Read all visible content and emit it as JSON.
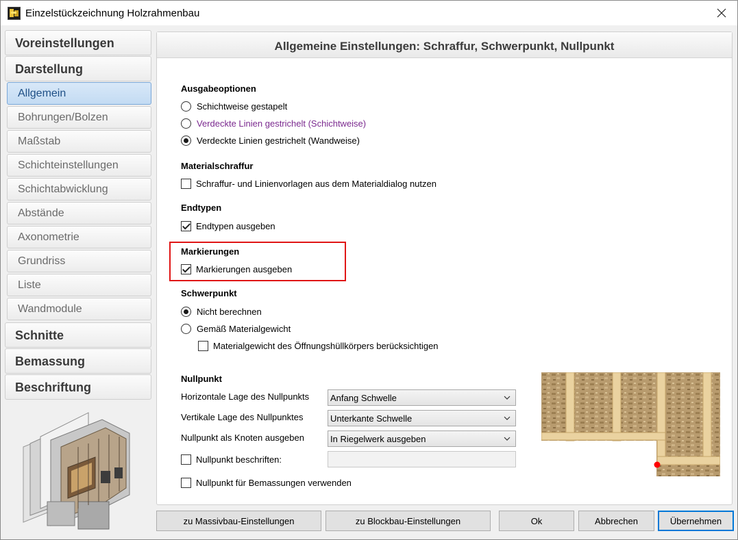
{
  "window": {
    "title": "Einzelstückzeichnung Holzrahmenbau"
  },
  "nav": {
    "voreinstellungen": "Voreinstellungen",
    "darstellung": "Darstellung",
    "allgemein": "Allgemein",
    "bohrungen": "Bohrungen/Bolzen",
    "massstab": "Maßstab",
    "schichteinstellungen": "Schichteinstellungen",
    "schichtabwicklung": "Schichtabwicklung",
    "abstaende": "Abstände",
    "axonometrie": "Axonometrie",
    "grundriss": "Grundriss",
    "liste": "Liste",
    "wandmodule": "Wandmodule",
    "schnitte": "Schnitte",
    "bemassung": "Bemassung",
    "beschriftung": "Beschriftung"
  },
  "panel": {
    "title": "Allgemeine Einstellungen: Schraffur, Schwerpunkt, Nullpunkt",
    "ausgabe": {
      "heading": "Ausgabeoptionen",
      "opt1": "Schichtweise gestapelt",
      "opt2": "Verdeckte Linien gestrichelt (Schichtweise)",
      "opt3": "Verdeckte Linien gestrichelt (Wandweise)",
      "selected": "Verdeckte Linien gestrichelt (Wandweise)"
    },
    "material": {
      "heading": "Materialschraffur",
      "check": "Schraffur- und Linienvorlagen aus dem Materialdialog nutzen",
      "checked": false
    },
    "endtypen": {
      "heading": "Endtypen",
      "check": "Endtypen ausgeben",
      "checked": true
    },
    "markierungen": {
      "heading": "Markierungen",
      "check": "Markierungen ausgeben",
      "checked": true
    },
    "schwerpunkt": {
      "heading": "Schwerpunkt",
      "opt1": "Nicht berechnen",
      "opt2": "Gemäß Materialgewicht",
      "sub_check": "Materialgewicht des Öffnungshüllkörpers berücksichtigen",
      "selected": "Nicht berechnen"
    },
    "nullpunkt": {
      "heading": "Nullpunkt",
      "horiz_label": "Horizontale Lage des Nullpunkts",
      "horiz_value": "Anfang Schwelle",
      "vert_label": "Vertikale Lage des Nullpunktes",
      "vert_value": "Unterkante Schwelle",
      "knoten_label": "Nullpunkt als Knoten ausgeben",
      "knoten_value": "In Riegelwerk ausgeben",
      "beschriften_label": "Nullpunkt beschriften:",
      "beschriften_value": "",
      "bemassung_label": "Nullpunkt für Bemassungen verwenden"
    }
  },
  "buttons": {
    "massivbau": "zu Massivbau-Einstellungen",
    "blockbau": "zu Blockbau-Einstellungen",
    "ok": "Ok",
    "abbrechen": "Abbrechen",
    "uebernehmen": "Übernehmen"
  },
  "colors": {
    "accent": "#0078d7",
    "highlight": "#e01515",
    "selected_nav": "#c3dbf3",
    "purple_text": "#7b2a8f"
  }
}
